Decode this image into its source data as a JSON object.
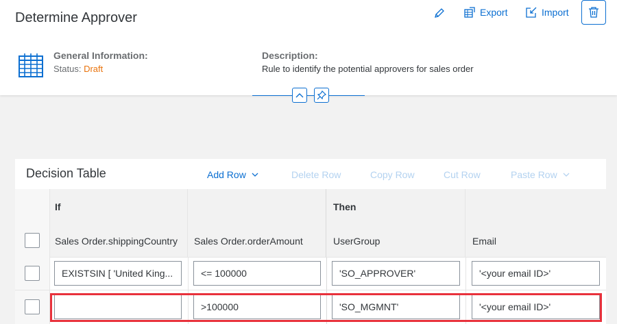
{
  "header": {
    "title": "Determine Approver",
    "actions": {
      "export_label": "Export",
      "import_label": "Import"
    },
    "general_information_label": "General Information:",
    "status_label": "Status:",
    "status_value": "Draft",
    "description_label": "Description:",
    "description_value": "Rule to identify the potential approvers for sales order"
  },
  "icons": [
    "pencil-icon",
    "export-icon",
    "import-icon",
    "trash-icon",
    "grid-table-icon",
    "chevron-up-icon",
    "pin-icon",
    "chevron-down-icon"
  ],
  "colors": {
    "accent": "#0a6ed1",
    "status_draft": "#e9730c",
    "highlight": "#e8313b",
    "disabled_action": "#b3d2f0"
  },
  "decision_table": {
    "title": "Decision Table",
    "actions": {
      "add_row": "Add Row",
      "delete_row": "Delete Row",
      "copy_row": "Copy Row",
      "cut_row": "Cut Row",
      "paste_row": "Paste Row"
    },
    "sections": {
      "if": "If",
      "then": "Then"
    },
    "columns": [
      "Sales Order.shippingCountry",
      "Sales Order.orderAmount",
      "UserGroup",
      "Email"
    ],
    "rows": [
      [
        "EXISTSIN [ 'United King...",
        "<= 100000",
        "'SO_APPROVER'",
        "'<your email ID>'"
      ],
      [
        "",
        ">100000",
        "'SO_MGMNT'",
        "'<your email ID>'"
      ]
    ]
  }
}
